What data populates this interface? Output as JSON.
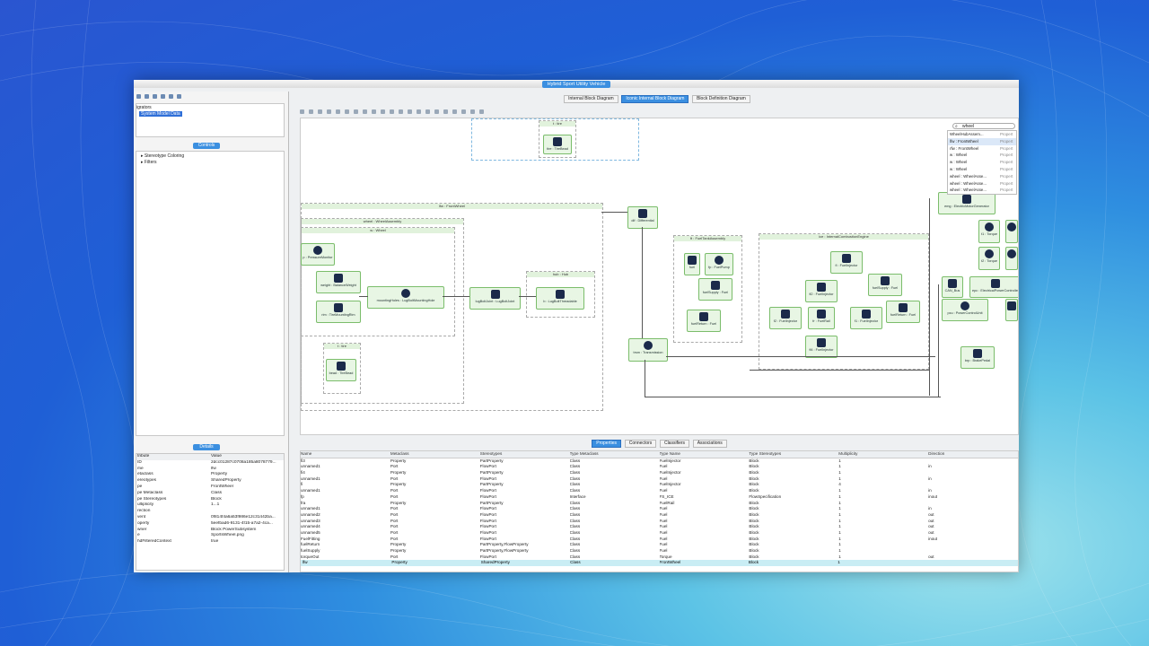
{
  "window_title": "Hybrid Sport Utility Vehicle",
  "left": {
    "navigators_label": "igrators",
    "tree_selected": "System Model Data",
    "controls_button": "Controls",
    "controls_items": [
      "Stereotype Coloring",
      "Filters"
    ],
    "details_button": "Details",
    "details_header": [
      "tribute",
      "Value"
    ],
    "details_rows": [
      [
        "ID",
        "2dcc01287c0708a185a8078779..."
      ],
      [
        "me",
        "lfw"
      ],
      [
        "etaclass",
        "Property"
      ],
      [
        "ereotypes",
        "SharedProperty"
      ],
      [
        "pe",
        "FrontWheel"
      ],
      [
        "pe Metaclass",
        "Class"
      ],
      [
        "pe Stereotypes",
        "Block"
      ],
      [
        "ultiplicity",
        "1...1"
      ],
      [
        "rection",
        ""
      ],
      [
        "vent",
        "0f814f4a6a53f986e12c31442ba..."
      ],
      [
        "operty",
        "5eefbad6-9131-4f15-a7a2-4ca..."
      ],
      [
        "wner",
        "Block PowerSubsystem"
      ],
      [
        "e",
        "SportsWheel.png"
      ],
      [
        "hdFilteredContext",
        "true"
      ]
    ]
  },
  "tabs": [
    "Internal Block Diagram",
    "Iconic Internal Block Diagram",
    "Block Definition Diagram"
  ],
  "active_tab": "Iconic Internal Block Diagram",
  "search": {
    "value": "wheel"
  },
  "search_results": [
    [
      "WheelHubAssem...",
      "Propert"
    ],
    [
      "lfw : FrontWheel",
      "Propert"
    ],
    [
      "rfw : FrontWheel",
      "Propert"
    ],
    [
      "w : Wheel",
      "Propert"
    ],
    [
      "w : Wheel",
      "Propert"
    ],
    [
      "w : Wheel",
      "Propert"
    ],
    [
      "wheel : WheelAsse...",
      "Propert"
    ],
    [
      "wheel : WheelAsse...",
      "Propert"
    ],
    [
      "wheel : WheelAsse...",
      "Propert"
    ]
  ],
  "diagram": {
    "blocks": {
      "b_tire_top": "t : tire",
      "lfw": "lfw : FrontWheel",
      "wheel_assembly": "wheel : WheelAssembly",
      "w_wheel": "w : Wheel",
      "hub": "hub : Hub",
      "ft_fuel_tank": "ft : FuelTankAssembly",
      "ice": "ice : InternalCombustionEngine",
      "t_tire_bottom": "t : tire"
    },
    "parts": {
      "tire_top": "tire : TireBead",
      "pressure": "p : PressureMonitor",
      "balance": "weight : BalanceWeight",
      "tiremount": "rim : TireMountingRim",
      "mount_hub": "mountingHoles : LugBoltMountingHole",
      "lugbolt_joint": "lugBoltJoint : LugBoltJoint",
      "lugbolt": "b : LugBoltThreadable",
      "tire_bottom": "bead : TireBead",
      "differential": "dif : Differential",
      "fuel": "fuel",
      "fuelpump": "fp : FuelPump",
      "fuelsupply_left": "fuelSupply : Fuel",
      "fuelreturn_left": "fuelReturn : Fuel",
      "injector_main": "fi : FuelInjector",
      "injector2": "fi2 : FuelInjector",
      "fuel_supply_right": "fuelSupply : Fuel",
      "rail": "fr : FuelRail",
      "injector_left": "f2 : FuelInjector",
      "injector_right": "f1 : FuelInjector",
      "fuel_return_right": "fuelReturn : Fuel",
      "injector_bottom": "fi4 : FuelInjector",
      "transmission": "trsm : Transmission",
      "emg": "emg : ElectricMotorGenerator",
      "torque1": "t1 : Torque",
      "torque2": "t2 : Torque",
      "bus": "CAN_Bus",
      "power_controller": "epc : ElectricalPowerController",
      "power_control_unit": "pcu : PowerControlUnit",
      "brake": "brp : BrakePedal"
    }
  },
  "bottom_tabs": [
    "Properties",
    "Connectors",
    "Classifiers",
    "Associations"
  ],
  "active_bottom_tab": "Properties",
  "table": {
    "columns": [
      "Name",
      "Metaclass",
      "Stereotypes",
      "Type Metaclass",
      "Type Name",
      "Type Stereotypes",
      "Multiplicity",
      "Direction"
    ],
    "rows": [
      [
        "fi3",
        "Property",
        "PartProperty",
        "Class",
        "FuelInjector",
        "Block",
        "1",
        ""
      ],
      [
        "unnamed1",
        "Port",
        "FlowPort",
        "Class",
        "Fuel",
        "Block",
        "1",
        "in"
      ],
      [
        "fi4",
        "Property",
        "PartProperty",
        "Class",
        "FuelInjector",
        "Block",
        "1",
        ""
      ],
      [
        "unnamed1",
        "Port",
        "FlowPort",
        "Class",
        "Fuel",
        "Block",
        "1",
        "in"
      ],
      [
        "fi",
        "Property",
        "PartProperty",
        "Class",
        "FuelInjector",
        "Block",
        "4",
        ""
      ],
      [
        "unnamed1",
        "Port",
        "FlowPort",
        "Class",
        "Fuel",
        "Block",
        "1",
        "in"
      ],
      [
        "fp",
        "Port",
        "FlowPort",
        "Interface",
        "FS_ICE",
        "FlowSpecification",
        "1",
        "inout"
      ],
      [
        "fra",
        "Property",
        "PartProperty",
        "Class",
        "FuelRail",
        "Block",
        "1",
        ""
      ],
      [
        "unnamed1",
        "Port",
        "FlowPort",
        "Class",
        "Fuel",
        "Block",
        "1",
        "in"
      ],
      [
        "unnamed2",
        "Port",
        "FlowPort",
        "Class",
        "Fuel",
        "Block",
        "1",
        "out"
      ],
      [
        "unnamed3",
        "Port",
        "FlowPort",
        "Class",
        "Fuel",
        "Block",
        "1",
        "out"
      ],
      [
        "unnamed4",
        "Port",
        "FlowPort",
        "Class",
        "Fuel",
        "Block",
        "1",
        "out"
      ],
      [
        "unnamed5",
        "Port",
        "FlowPort",
        "Class",
        "Fuel",
        "Block",
        "1",
        "out"
      ],
      [
        "FuelFitting",
        "Port",
        "FlowPort",
        "Class",
        "Fuel",
        "Block",
        "1",
        "inout"
      ],
      [
        "fuelReturn",
        "Property",
        "PartProperty,FlowProperty",
        "Class",
        "Fuel",
        "Block",
        "1",
        ""
      ],
      [
        "fuelSupply",
        "Property",
        "PartProperty,FlowProperty",
        "Class",
        "Fuel",
        "Block",
        "1",
        ""
      ],
      [
        "torqueOut",
        "Port",
        "FlowPort",
        "Class",
        "Torque",
        "Block",
        "1",
        "out"
      ],
      [
        "lfw",
        "Property",
        "SharedProperty",
        "Class",
        "FrontWheel",
        "Block",
        "1",
        ""
      ]
    ],
    "selected_row": 17
  }
}
